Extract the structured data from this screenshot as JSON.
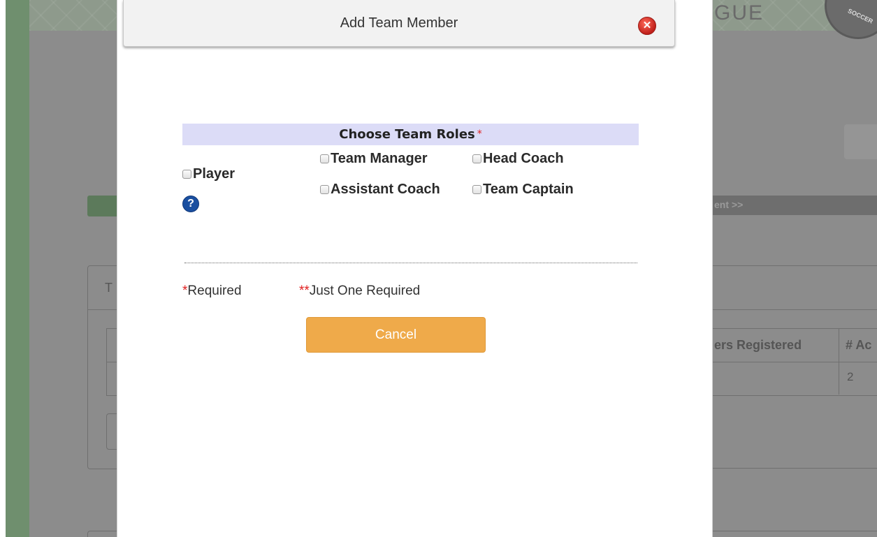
{
  "background": {
    "league_text": "GUE",
    "seal_text": "SOCCER",
    "step_text": "ent >>",
    "left_panel_letter": "T",
    "table_header_registered": "ers Registered",
    "table_header_ac": "# Ac",
    "table_value": "2"
  },
  "modal": {
    "title": "Add Team Member",
    "close_glyph": "✕",
    "roles_header": "Choose Team Roles",
    "roles_required_marker": "*",
    "roles": {
      "player": "Player",
      "team_manager": "Team Manager",
      "head_coach": "Head Coach",
      "assistant_coach": "Assistant Coach",
      "team_captain": "Team Captain"
    },
    "help_glyph": "?",
    "legend": {
      "required_marker": "*",
      "required_text": "Required",
      "one_marker": "**",
      "one_text": "Just One Required"
    },
    "cancel_label": "Cancel"
  },
  "colors": {
    "roles_header_bg": "#dcdcf7",
    "cancel_bg": "#efaa4a",
    "required_red": "#e02020",
    "help_blue": "#1a4fa0"
  }
}
